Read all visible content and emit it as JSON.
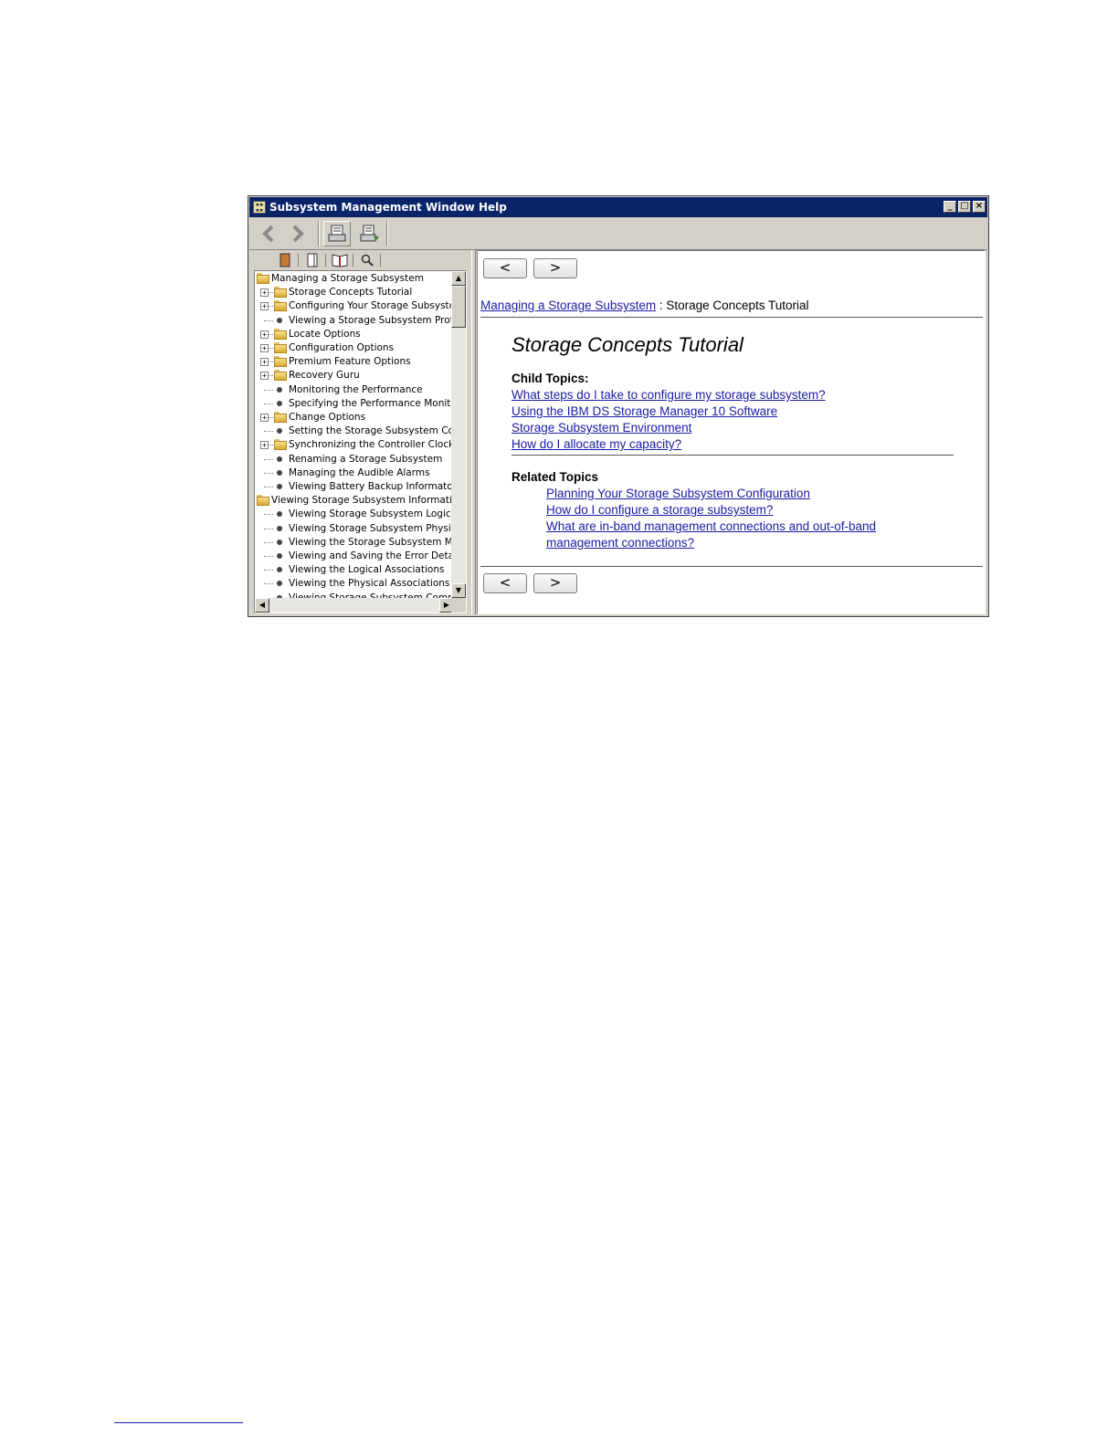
{
  "window": {
    "title": "Subsystem Management Window Help"
  },
  "toolbar": {
    "back_icon": "chevron-left-icon",
    "forward_icon": "chevron-right-icon",
    "hide_icon": "hide-pane-icon",
    "print_icon": "print-icon"
  },
  "tree": {
    "items": [
      {
        "label": "Managing a Storage Subsystem",
        "level": 0,
        "kind": "folder-open",
        "expander": false
      },
      {
        "label": "Storage Concepts Tutorial",
        "level": 1,
        "kind": "folder",
        "expander": true
      },
      {
        "label": "Configuring Your Storage Subsystem",
        "level": 1,
        "kind": "folder",
        "expander": true
      },
      {
        "label": "Viewing a Storage Subsystem Profile",
        "level": 1,
        "kind": "page",
        "expander": false
      },
      {
        "label": "Locate Options",
        "level": 1,
        "kind": "folder",
        "expander": true
      },
      {
        "label": "Configuration Options",
        "level": 1,
        "kind": "folder",
        "expander": true
      },
      {
        "label": "Premium Feature Options",
        "level": 1,
        "kind": "folder",
        "expander": true
      },
      {
        "label": "Recovery Guru",
        "level": 1,
        "kind": "folder",
        "expander": true
      },
      {
        "label": "Monitoring the Performance",
        "level": 1,
        "kind": "page",
        "expander": false
      },
      {
        "label": "Specifying the Performance Monitor Set",
        "level": 1,
        "kind": "page",
        "expander": false
      },
      {
        "label": "Change Options",
        "level": 1,
        "kind": "folder",
        "expander": true
      },
      {
        "label": "Setting the Storage Subsystem Control",
        "level": 1,
        "kind": "page",
        "expander": false
      },
      {
        "label": "Synchronizing the Controller Clocks",
        "level": 1,
        "kind": "folder",
        "expander": true
      },
      {
        "label": "Renaming a Storage Subsystem",
        "level": 1,
        "kind": "page",
        "expander": false
      },
      {
        "label": "Managing the Audible Alarms",
        "level": 1,
        "kind": "page",
        "expander": false
      },
      {
        "label": "Viewing Battery Backup Informaton",
        "level": 1,
        "kind": "page",
        "expander": false
      },
      {
        "label": "Viewing Storage Subsystem Information",
        "level": 0,
        "kind": "folder-open",
        "expander": false
      },
      {
        "label": "Viewing Storage Subsystem Logical Con",
        "level": 1,
        "kind": "page",
        "expander": false
      },
      {
        "label": "Viewing Storage Subsystem Physical Co",
        "level": 1,
        "kind": "page",
        "expander": false
      },
      {
        "label": "Viewing the Storage Subsystem Mappin",
        "level": 1,
        "kind": "page",
        "expander": false
      },
      {
        "label": "Viewing and Saving the Error Details",
        "level": 1,
        "kind": "page",
        "expander": false
      },
      {
        "label": "Viewing the Logical Associations",
        "level": 1,
        "kind": "page",
        "expander": false
      },
      {
        "label": "Viewing the Physical Associations",
        "level": 1,
        "kind": "page",
        "expander": false
      },
      {
        "label": "Viewing Storage Subsystem Compon",
        "level": 1,
        "kind": "page",
        "expander": false
      }
    ]
  },
  "content": {
    "prev_label": "<",
    "next_label": ">",
    "breadcrumb_link": "Managing a Storage Subsystem",
    "breadcrumb_sep": " : ",
    "breadcrumb_current": "Storage Concepts Tutorial",
    "heading": "Storage Concepts Tutorial",
    "child_topics_label": "Child Topics:",
    "child_topics": [
      "What steps do I take to configure my storage subsystem?",
      "Using the IBM DS Storage Manager 10 Software",
      "Storage Subsystem Environment",
      "How do I allocate my capacity?"
    ],
    "related_topics_label": "Related Topics",
    "related_topics": [
      "Planning Your Storage Subsystem Configuration",
      "How do I configure a storage subsystem?",
      "What are in-band management connections and out-of-band",
      "management connections?"
    ]
  }
}
